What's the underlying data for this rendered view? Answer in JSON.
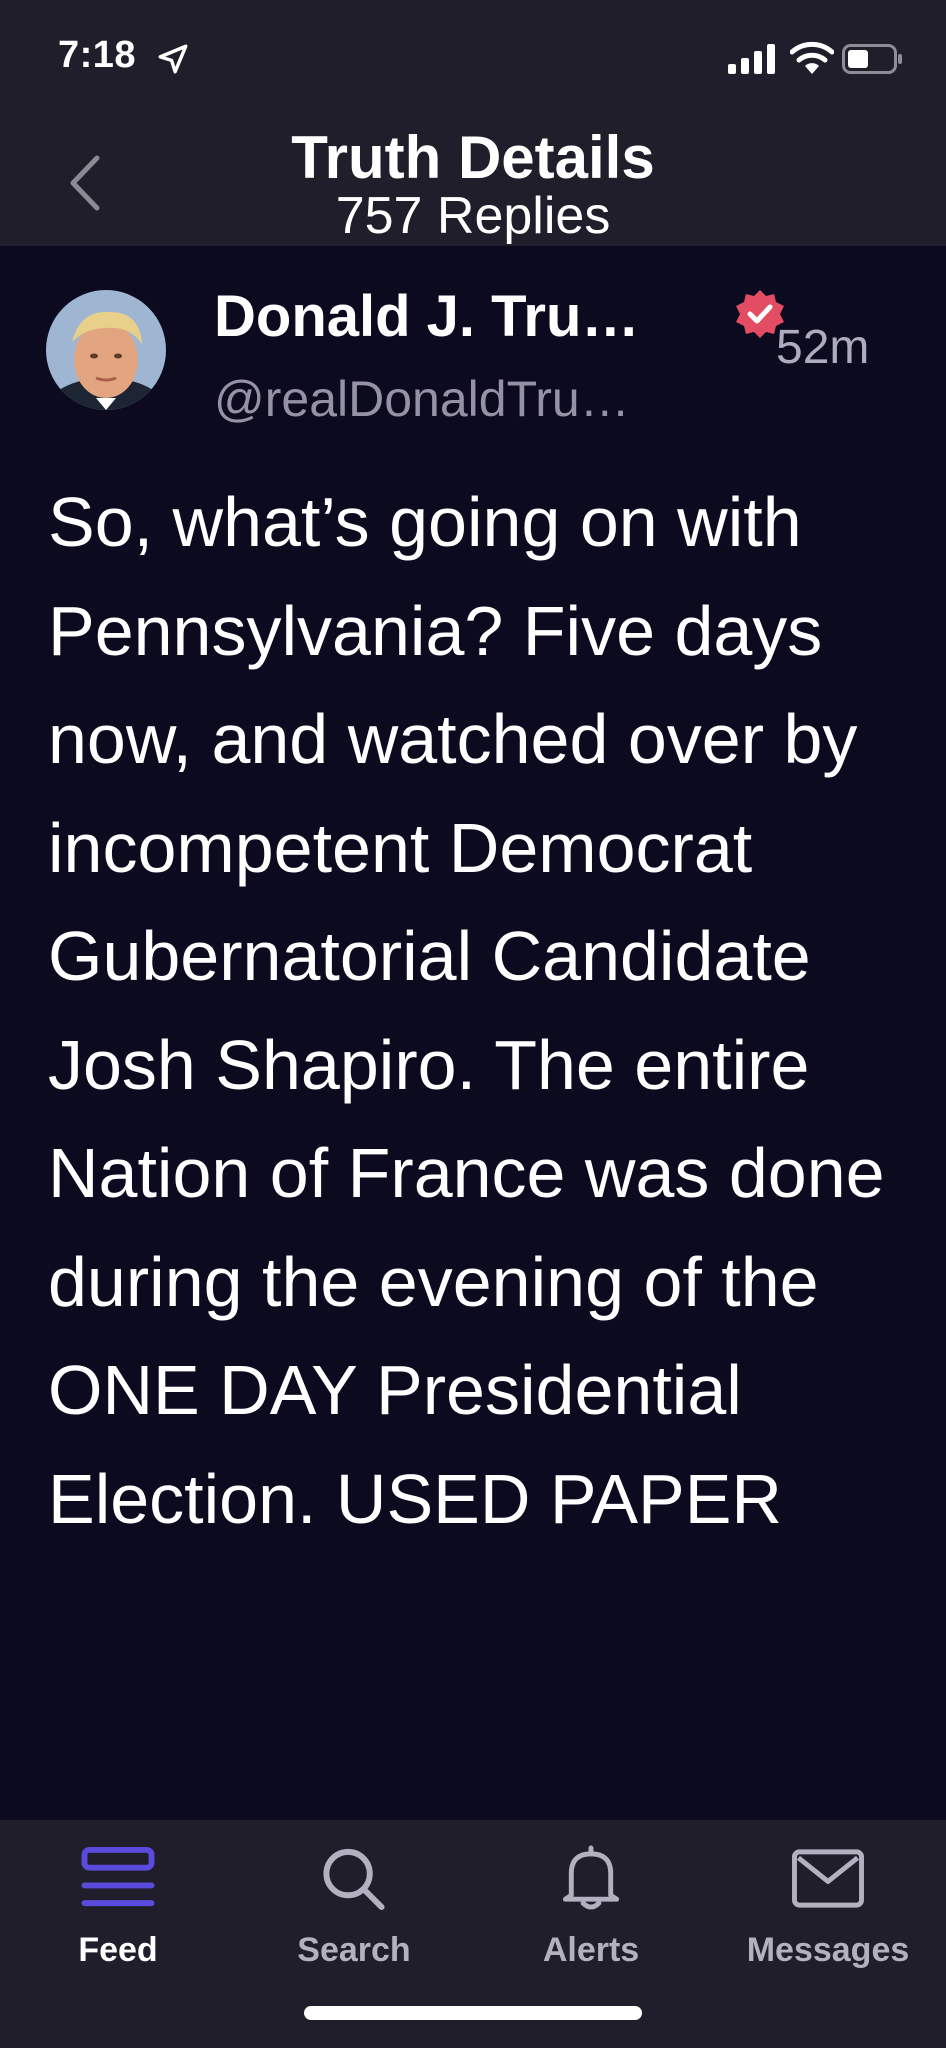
{
  "status_bar": {
    "time": "7:18",
    "icons": [
      "location-arrow-icon",
      "cellular-signal-icon",
      "wifi-icon",
      "battery-icon"
    ]
  },
  "header": {
    "title": "Truth Details",
    "subtitle": "757 Replies",
    "back_icon": "chevron-left-icon"
  },
  "post": {
    "author_name": "Donald J. Tru…",
    "handle": "@realDonaldTru…",
    "time_ago": "52m",
    "verified": true,
    "body": "So, what’s going on with Pennsylvania? Five days now, and watched over by incompetent Democrat Gubernatorial Candidate Josh Shapiro. The entire Nation of France was done during the evening of the ONE DAY Presidential Election. USED PAPER"
  },
  "tabs": [
    {
      "label": "Feed",
      "icon": "feed-icon",
      "active": true
    },
    {
      "label": "Search",
      "icon": "search-icon",
      "active": false
    },
    {
      "label": "Alerts",
      "icon": "bell-icon",
      "active": false
    },
    {
      "label": "Messages",
      "icon": "envelope-icon",
      "active": false
    }
  ],
  "colors": {
    "background": "#0c0a1f",
    "bar_background": "#1f1e2a",
    "accent": "#5a4bdc",
    "verified": "#e24d64",
    "muted_text": "#9592a6"
  }
}
